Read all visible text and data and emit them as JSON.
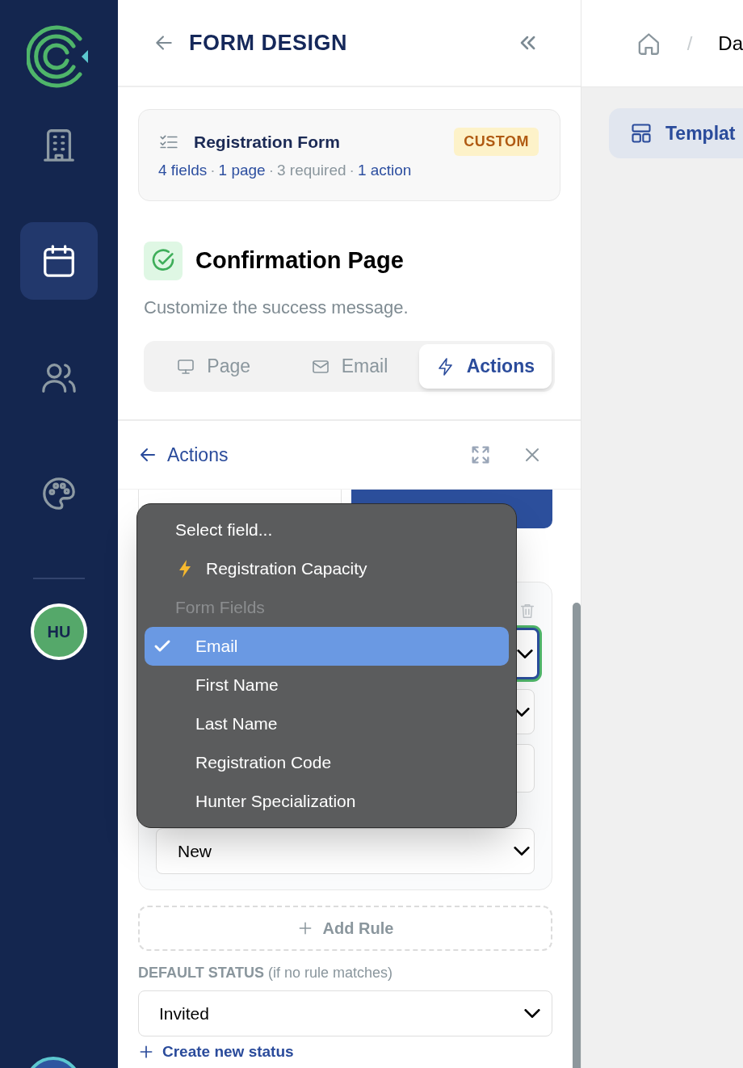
{
  "sidebar": {
    "items": [
      {
        "kind": "building",
        "selected": false
      },
      {
        "kind": "calendar",
        "selected": true
      },
      {
        "kind": "users",
        "selected": false
      },
      {
        "kind": "palette",
        "selected": false
      }
    ],
    "avatar": "HU"
  },
  "panel": {
    "title": "FORM DESIGN"
  },
  "form_card": {
    "title": "Registration Form",
    "badge": "CUSTOM",
    "separator": "·",
    "meta": [
      {
        "text": "4 fields",
        "kind": "link"
      },
      {
        "text": "1 page",
        "kind": "link"
      },
      {
        "text": "3 required",
        "kind": "muted"
      },
      {
        "text": "1 action",
        "kind": "link"
      }
    ]
  },
  "section": {
    "title": "Confirmation Page",
    "subtitle": "Customize the success message.",
    "tabs": [
      {
        "kind": "monitor",
        "label": "Page",
        "selected": false
      },
      {
        "kind": "mail",
        "label": "Email",
        "selected": false
      },
      {
        "kind": "bolt",
        "label": "Actions",
        "selected": true
      }
    ]
  },
  "actions_bar": {
    "title": "Actions"
  },
  "mode_buttons": [
    {
      "selected": false
    },
    {
      "selected": true
    }
  ],
  "rule": {
    "fields": [
      {
        "kind": "select",
        "focused": true
      },
      {
        "kind": "select",
        "focused": false
      },
      {
        "kind": "input",
        "focused": false
      },
      {
        "kind": "select",
        "focused": false,
        "value": "New"
      }
    ]
  },
  "add_rule": "Add Rule",
  "default_status": {
    "label": "**DEFAULT STATUS** (if no rule matches)",
    "value": "Invited"
  },
  "create_link": "Create new status",
  "dropdown": {
    "items": [
      {
        "kind": "placeholder",
        "label": "Select field..."
      },
      {
        "kind": "action",
        "label": "Registration Capacity"
      },
      {
        "kind": "header",
        "label": "Form Fields"
      },
      {
        "kind": "option",
        "label": "Email",
        "selected": true
      },
      {
        "kind": "option",
        "label": "First Name",
        "selected": false
      },
      {
        "kind": "option",
        "label": "Last Name",
        "selected": false
      },
      {
        "kind": "option",
        "label": "Registration Code",
        "selected": false
      },
      {
        "kind": "option",
        "label": "Hunter Specialization",
        "selected": false
      }
    ]
  },
  "breadcrumb": {
    "separator": "/",
    "current": "Da"
  },
  "template_button": "Templat"
}
